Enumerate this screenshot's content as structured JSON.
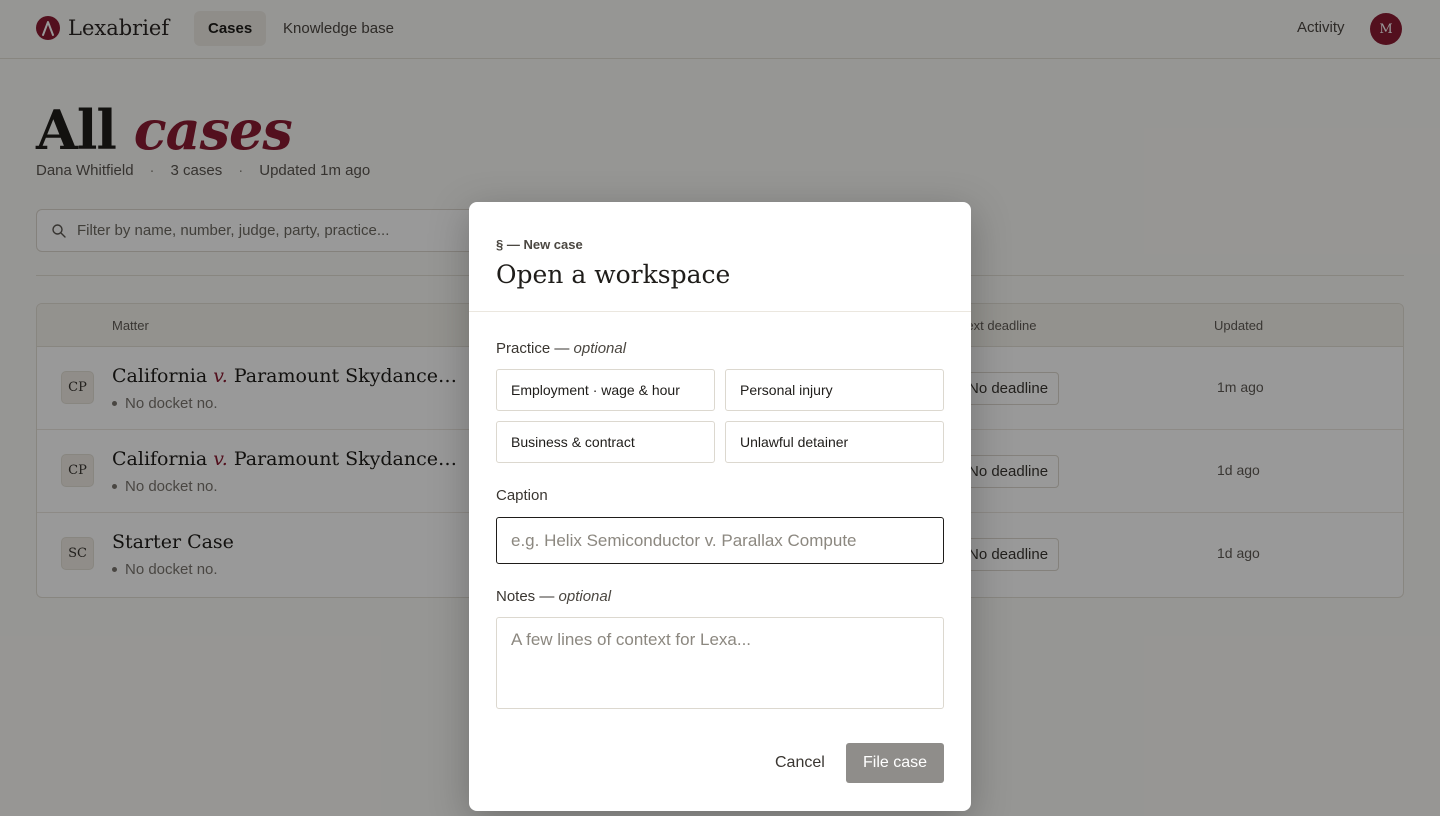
{
  "nav": {
    "brand": "Lexabrief",
    "tabs": [
      "Cases",
      "Knowledge base"
    ],
    "activity": "Activity",
    "avatar_initial": "M"
  },
  "page": {
    "title_main": "All",
    "title_accent": "cases",
    "owner": "Dana Whitfield",
    "count": "3 cases",
    "updated": "Updated 1m ago",
    "filter_placeholder": "Filter by name, number, judge, party, practice..."
  },
  "table": {
    "headers": {
      "matter": "Matter",
      "next_deadline": "Next deadline",
      "updated": "Updated"
    },
    "rows": [
      {
        "initials": "CP",
        "name_a": "California",
        "vs": "v.",
        "name_b": "Paramount Skydance Corp.",
        "docket": "No docket no.",
        "deadline": "No deadline",
        "updated": "1m ago"
      },
      {
        "initials": "CP",
        "name_a": "California",
        "vs": "v.",
        "name_b": "Paramount Skydance - PI li...",
        "docket": "No docket no.",
        "deadline": "No deadline",
        "updated": "1d ago"
      },
      {
        "initials": "SC",
        "name_a": "Starter Case",
        "vs": "",
        "name_b": "",
        "docket": "No docket no.",
        "deadline": "No deadline",
        "updated": "1d ago"
      }
    ]
  },
  "modal": {
    "eyebrow": "§ — New case",
    "title": "Open a workspace",
    "practice_label": "Practice —",
    "optional": "optional",
    "practice_options": [
      "Employment · wage & hour",
      "Personal injury",
      "Business & contract",
      "Unlawful detainer"
    ],
    "caption_label": "Caption",
    "caption_placeholder": "e.g. Helix Semiconductor v. Parallax Compute",
    "notes_label": "Notes —",
    "notes_placeholder": "A few lines of context for Lexa...",
    "cancel": "Cancel",
    "submit": "File case"
  },
  "colors": {
    "brand": "#8a1c32",
    "overlay": "rgba(0,0,0,0.4)",
    "disabled_button": "#8f8d8a"
  }
}
